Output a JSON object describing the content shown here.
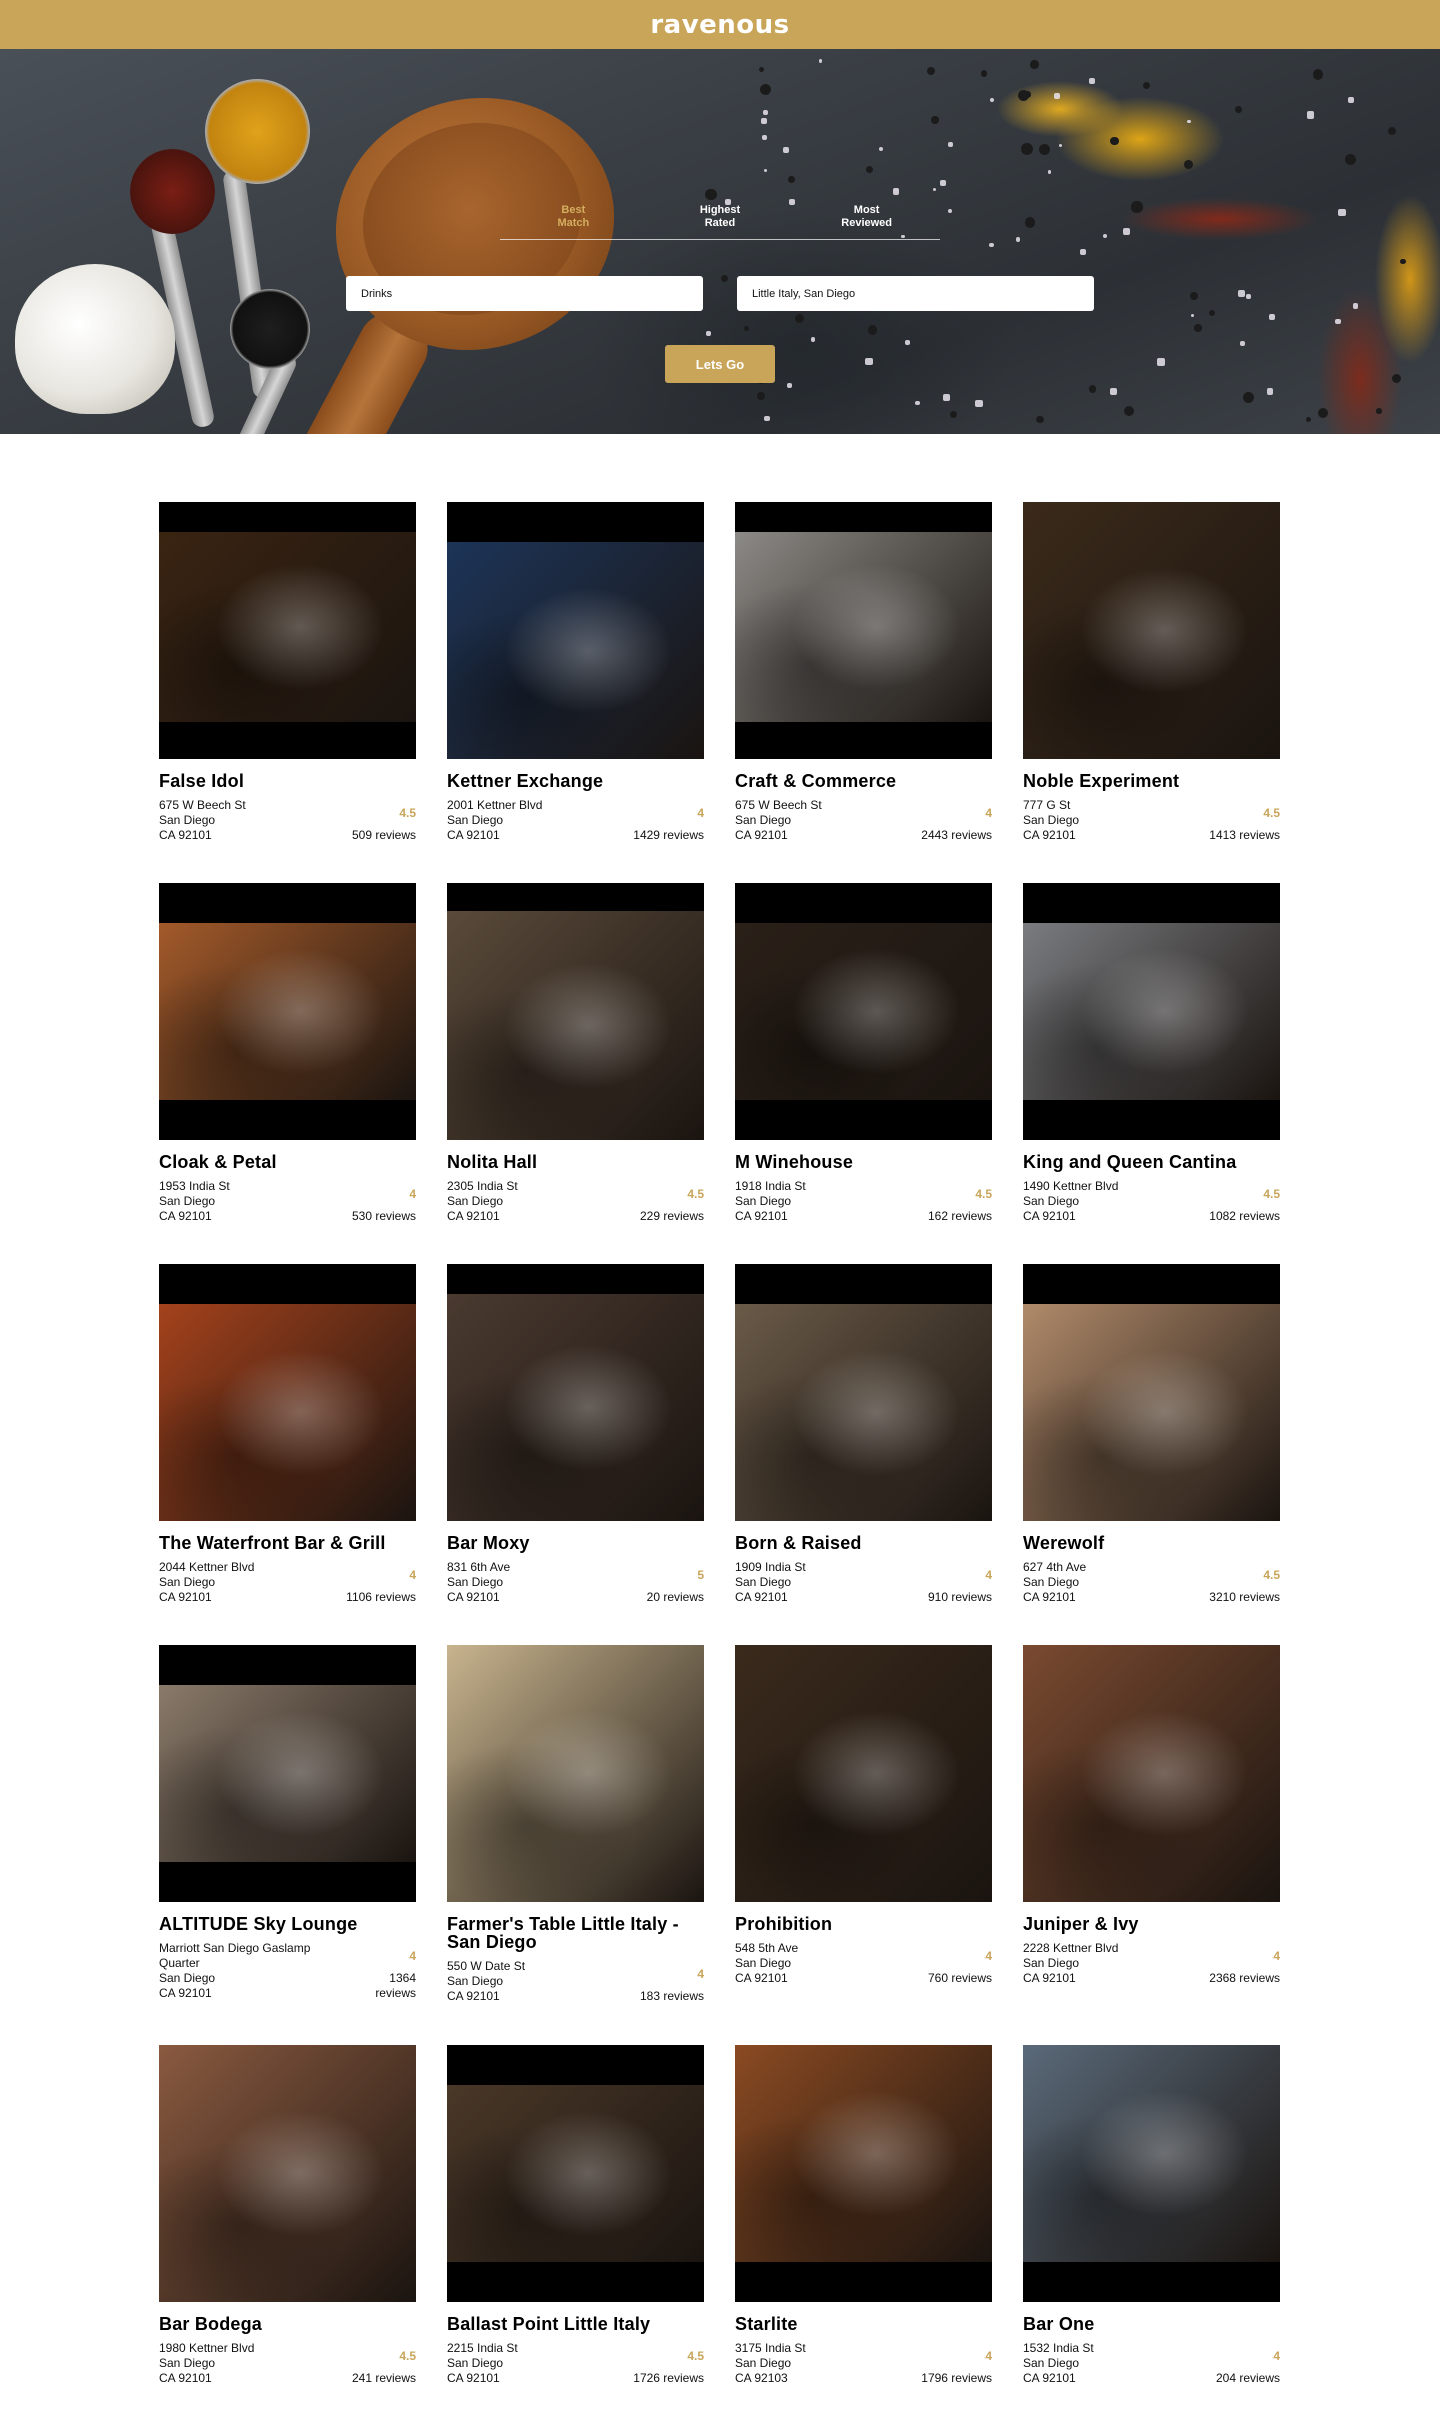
{
  "app": {
    "brand": "ravenous"
  },
  "hero": {
    "sort_tabs": [
      {
        "label": "Best\nMatch",
        "active": true
      },
      {
        "label": "Highest\nRated",
        "active": false
      },
      {
        "label": "Most\nReviewed",
        "active": false
      }
    ],
    "search_terms_value": "Drinks",
    "location_value": "Little Italy, San Diego",
    "submit_label": "Lets Go"
  },
  "businesses": [
    {
      "name": "False Idol",
      "address": "675 W Beech St",
      "city": "San Diego",
      "state_zip": "CA 92101",
      "rating": "4.5",
      "reviews": "509 reviews",
      "photo_icon": "bar-interior-photo",
      "tone": "#3a2412"
    },
    {
      "name": "Kettner Exchange",
      "address": "2001 Kettner Blvd",
      "city": "San Diego",
      "state_zip": "CA 92101",
      "rating": "4",
      "reviews": "1429 reviews",
      "photo_icon": "building-exterior-photo",
      "tone": "#1c3458"
    },
    {
      "name": "Craft & Commerce",
      "address": "675 W Beech St",
      "city": "San Diego",
      "state_zip": "CA 92101",
      "rating": "4",
      "reviews": "2443 reviews",
      "photo_icon": "food-plate-photo",
      "tone": "#8c8a86"
    },
    {
      "name": "Noble Experiment",
      "address": "777 G St",
      "city": "San Diego",
      "state_zip": "CA 92101",
      "rating": "4.5",
      "reviews": "1413 reviews",
      "photo_icon": "bar-interior-photo",
      "tone": "#3b2a1a"
    },
    {
      "name": "Cloak & Petal",
      "address": "1953 India St",
      "city": "San Diego",
      "state_zip": "CA 92101",
      "rating": "4",
      "reviews": "530 reviews",
      "photo_icon": "food-plate-photo",
      "tone": "#a35a2a"
    },
    {
      "name": "Nolita Hall",
      "address": "2305 India St",
      "city": "San Diego",
      "state_zip": "CA 92101",
      "rating": "4.5",
      "reviews": "229 reviews",
      "photo_icon": "food-plate-photo",
      "tone": "#5a4a3a"
    },
    {
      "name": "M Winehouse",
      "address": "1918 India St",
      "city": "San Diego",
      "state_zip": "CA 92101",
      "rating": "4.5",
      "reviews": "162 reviews",
      "photo_icon": "bar-interior-photo",
      "tone": "#2a2018"
    },
    {
      "name": "King and Queen Cantina",
      "address": "1490 Kettner Blvd",
      "city": "San Diego",
      "state_zip": "CA 92101",
      "rating": "4.5",
      "reviews": "1082 reviews",
      "photo_icon": "building-exterior-photo",
      "tone": "#7a7c80"
    },
    {
      "name": "The Waterfront Bar & Grill",
      "address": "2044 Kettner Blvd",
      "city": "San Diego",
      "state_zip": "CA 92101",
      "rating": "4",
      "reviews": "1106 reviews",
      "photo_icon": "food-plate-photo",
      "tone": "#a4421c"
    },
    {
      "name": "Bar Moxy",
      "address": "831 6th Ave",
      "city": "San Diego",
      "state_zip": "CA 92101",
      "rating": "5",
      "reviews": "20 reviews",
      "photo_icon": "bar-interior-photo",
      "tone": "#4a3a30"
    },
    {
      "name": "Born & Raised",
      "address": "1909 India St",
      "city": "San Diego",
      "state_zip": "CA 92101",
      "rating": "4",
      "reviews": "910 reviews",
      "photo_icon": "food-plate-photo",
      "tone": "#6a5a48"
    },
    {
      "name": "Werewolf",
      "address": "627 4th Ave",
      "city": "San Diego",
      "state_zip": "CA 92101",
      "rating": "4.5",
      "reviews": "3210 reviews",
      "photo_icon": "food-plate-photo",
      "tone": "#b08a6a"
    },
    {
      "name": "ALTITUDE Sky Lounge",
      "address": "Marriott San Diego Gaslamp Quarter",
      "city": "San Diego",
      "state_zip": "CA 92101",
      "rating": "4",
      "reviews": "1364 reviews",
      "photo_icon": "city-skyline-photo",
      "tone": "#8a7a6a"
    },
    {
      "name": "Farmer's Table Little Italy - San Diego",
      "address": "550 W Date St",
      "city": "San Diego",
      "state_zip": "CA 92101",
      "rating": "4",
      "reviews": "183 reviews",
      "photo_icon": "food-plate-photo",
      "tone": "#c8b48e"
    },
    {
      "name": "Prohibition",
      "address": "548 5th Ave",
      "city": "San Diego",
      "state_zip": "CA 92101",
      "rating": "4",
      "reviews": "760 reviews",
      "photo_icon": "cocktail-glass-photo",
      "tone": "#3a2a1c"
    },
    {
      "name": "Juniper & Ivy",
      "address": "2228 Kettner Blvd",
      "city": "San Diego",
      "state_zip": "CA 92101",
      "rating": "4",
      "reviews": "2368 reviews",
      "photo_icon": "food-plate-photo",
      "tone": "#7a4a30"
    },
    {
      "name": "Bar Bodega",
      "address": "1980 Kettner Blvd",
      "city": "San Diego",
      "state_zip": "CA 92101",
      "rating": "4.5",
      "reviews": "241 reviews",
      "photo_icon": "food-plate-photo",
      "tone": "#8a5a40"
    },
    {
      "name": "Ballast Point Little Italy",
      "address": "2215 India St",
      "city": "San Diego",
      "state_zip": "CA 92101",
      "rating": "4.5",
      "reviews": "1726 reviews",
      "photo_icon": "bar-interior-photo",
      "tone": "#4a3828"
    },
    {
      "name": "Starlite",
      "address": "3175 India St",
      "city": "San Diego",
      "state_zip": "CA 92103",
      "rating": "4",
      "reviews": "1796 reviews",
      "photo_icon": "bar-interior-photo",
      "tone": "#8a4a22"
    },
    {
      "name": "Bar One",
      "address": "1532 India St",
      "city": "San Diego",
      "state_zip": "CA 92101",
      "rating": "4",
      "reviews": "204 reviews",
      "photo_icon": "food-plate-photo",
      "tone": "#5a6a7a"
    }
  ]
}
